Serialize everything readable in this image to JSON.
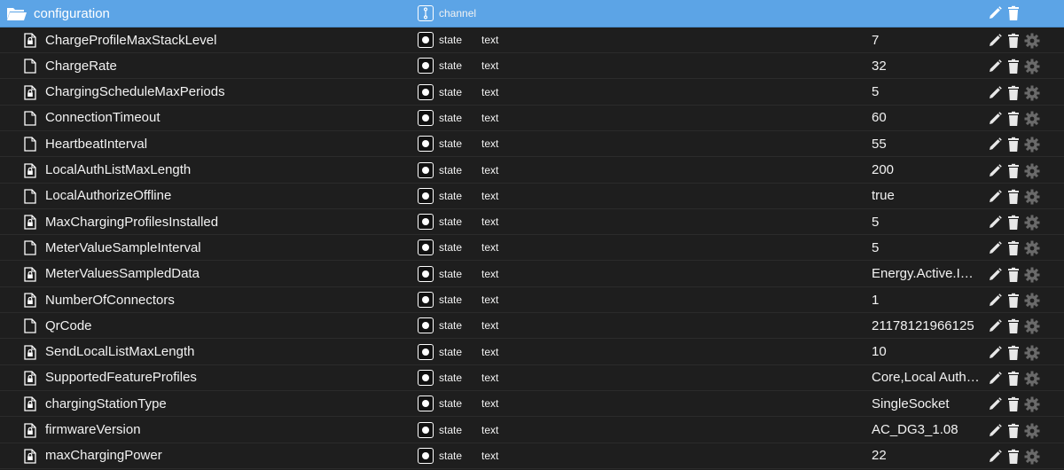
{
  "header": {
    "name": "configuration",
    "type_label": "channel",
    "icon": "folder-open-icon",
    "color": "#5ca4e6"
  },
  "rows": [
    {
      "name": "ChargeProfileMaxStackLevel",
      "type": "state",
      "role": "text",
      "value": "7",
      "locked": true
    },
    {
      "name": "ChargeRate",
      "type": "state",
      "role": "text",
      "value": "32",
      "locked": false
    },
    {
      "name": "ChargingScheduleMaxPeriods",
      "type": "state",
      "role": "text",
      "value": "5",
      "locked": true
    },
    {
      "name": "ConnectionTimeout",
      "type": "state",
      "role": "text",
      "value": "60",
      "locked": false
    },
    {
      "name": "HeartbeatInterval",
      "type": "state",
      "role": "text",
      "value": "55",
      "locked": false
    },
    {
      "name": "LocalAuthListMaxLength",
      "type": "state",
      "role": "text",
      "value": "200",
      "locked": true
    },
    {
      "name": "LocalAuthorizeOffline",
      "type": "state",
      "role": "text",
      "value": "true",
      "locked": false
    },
    {
      "name": "MaxChargingProfilesInstalled",
      "type": "state",
      "role": "text",
      "value": "5",
      "locked": true
    },
    {
      "name": "MeterValueSampleInterval",
      "type": "state",
      "role": "text",
      "value": "5",
      "locked": false
    },
    {
      "name": "MeterValuesSampledData",
      "type": "state",
      "role": "text",
      "value": "Energy.Active.Im...",
      "locked": true
    },
    {
      "name": "NumberOfConnectors",
      "type": "state",
      "role": "text",
      "value": "1",
      "locked": true
    },
    {
      "name": "QrCode",
      "type": "state",
      "role": "text",
      "value": "21178121966125",
      "locked": false
    },
    {
      "name": "SendLocalListMaxLength",
      "type": "state",
      "role": "text",
      "value": "10",
      "locked": true
    },
    {
      "name": "SupportedFeatureProfiles",
      "type": "state",
      "role": "text",
      "value": "Core,Local Auth L...",
      "locked": true
    },
    {
      "name": "chargingStationType",
      "type": "state",
      "role": "text",
      "value": "SingleSocket",
      "locked": true
    },
    {
      "name": "firmwareVersion",
      "type": "state",
      "role": "text",
      "value": "AC_DG3_1.08",
      "locked": true
    },
    {
      "name": "maxChargingPower",
      "type": "state",
      "role": "text",
      "value": "22",
      "locked": true
    }
  ],
  "icons": {
    "edit": "pencil-icon",
    "delete": "trash-icon",
    "settings": "gear-icon",
    "file": "file-icon",
    "locked_file": "file-lock-icon"
  }
}
